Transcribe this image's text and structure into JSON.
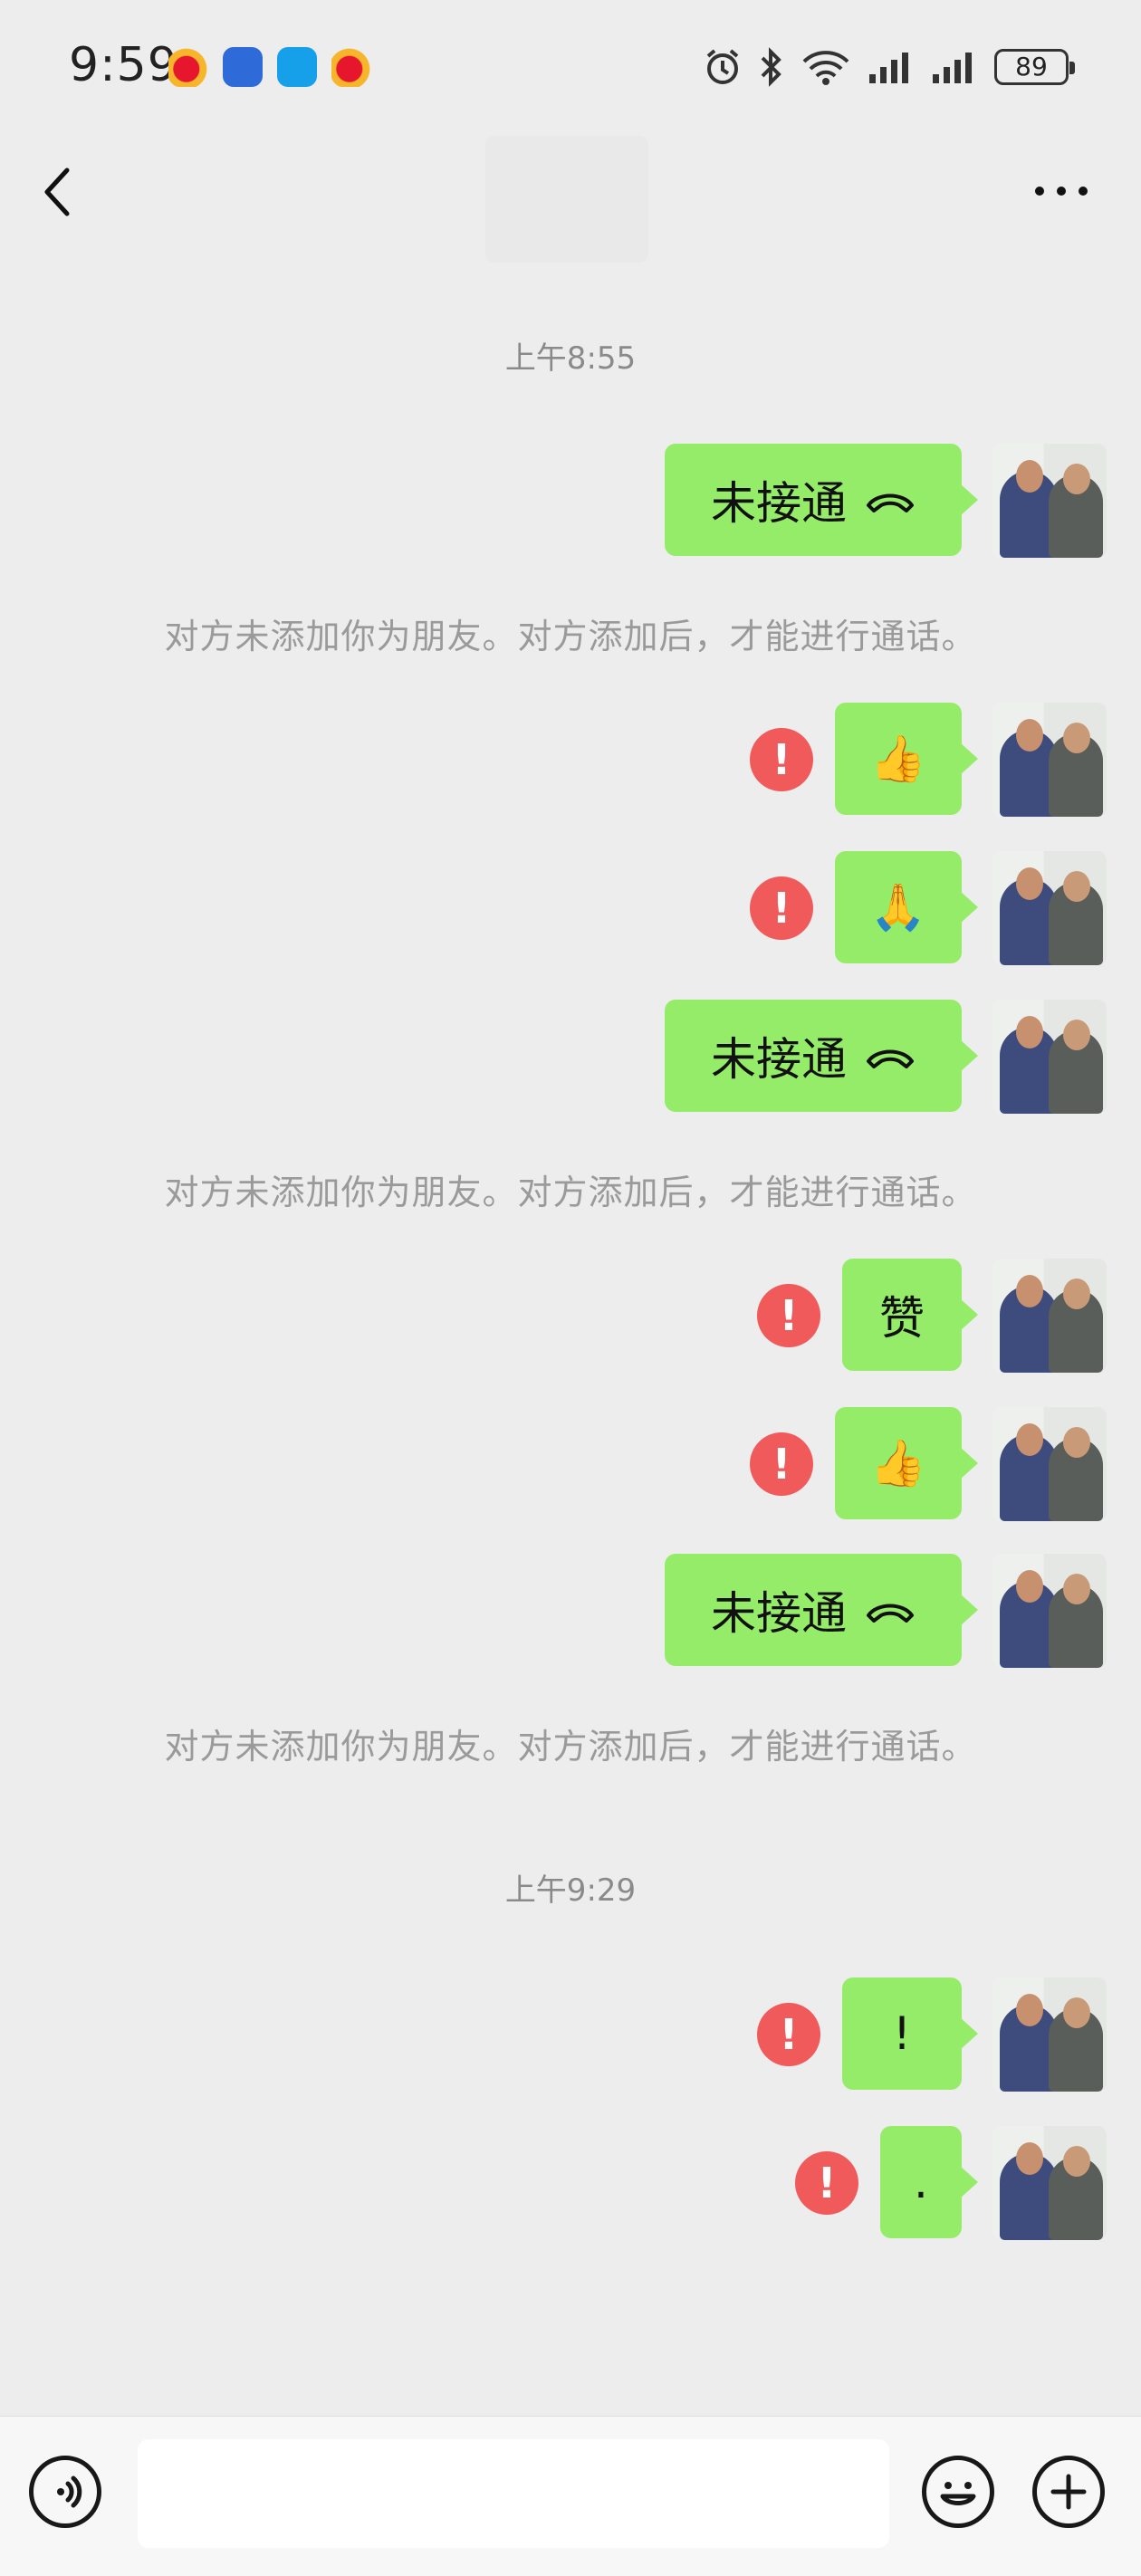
{
  "status_bar": {
    "time": "9:59",
    "battery": "89",
    "icons": [
      "weibo-icon",
      "blue-app-icon",
      "message-app-icon",
      "weibo-icon",
      "alarm-icon",
      "bluetooth-icon",
      "wifi-icon",
      "signal-icon",
      "signal-icon",
      "battery-icon"
    ]
  },
  "header": {
    "back_icon": "chevron-left-icon",
    "more_icon": "ellipsis-icon"
  },
  "timestamps": [
    "上午8:55",
    "上午9:29"
  ],
  "messages": [
    {
      "type": "call",
      "text": "未接通"
    },
    {
      "type": "system",
      "text": "对方未添加你为朋友。对方添加后，才能进行通话。"
    },
    {
      "type": "emoji",
      "text": "👍",
      "failed": true
    },
    {
      "type": "emoji",
      "text": "🙏",
      "failed": true
    },
    {
      "type": "call",
      "text": "未接通"
    },
    {
      "type": "system",
      "text": "对方未添加你为朋友。对方添加后，才能进行通话。"
    },
    {
      "type": "text",
      "text": "赞",
      "failed": true
    },
    {
      "type": "emoji",
      "text": "👍",
      "failed": true
    },
    {
      "type": "call",
      "text": "未接通"
    },
    {
      "type": "system",
      "text": "对方未添加你为朋友。对方添加后，才能进行通话。"
    },
    {
      "type": "text",
      "text": "!",
      "failed": true
    },
    {
      "type": "text",
      "text": ".",
      "failed": true
    }
  ],
  "error_mark": "!",
  "input_bar": {
    "value": "",
    "voice_icon": "voice-icon",
    "emoji_icon": "emoji-icon",
    "plus_icon": "plus-icon"
  },
  "colors": {
    "background": "#ededed",
    "bubble": "#95ec69",
    "error": "#f05a5a"
  }
}
